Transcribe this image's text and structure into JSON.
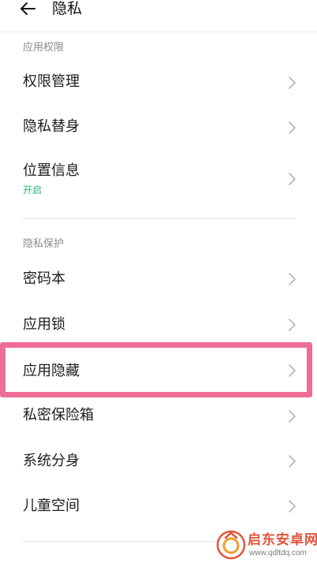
{
  "header": {
    "back_icon": "arrow-left-icon",
    "title": "隐私"
  },
  "colors": {
    "accent_green": "#2bb673",
    "highlight_pink": "#ee6d95",
    "chevron_gray": "#b4b4b4",
    "watermark_orange": "#e0553b"
  },
  "sections": [
    {
      "title": "应用权限",
      "items": [
        {
          "label": "权限管理"
        },
        {
          "label": "隐私替身"
        },
        {
          "label": "位置信息",
          "sub": "开启"
        }
      ]
    },
    {
      "title": "隐私保护",
      "items": [
        {
          "label": "密码本"
        },
        {
          "label": "应用锁"
        },
        {
          "label": "应用隐藏",
          "highlighted": true
        },
        {
          "label": "私密保险箱"
        },
        {
          "label": "系统分身"
        },
        {
          "label": "儿童空间"
        }
      ]
    }
  ],
  "watermark": {
    "name": "启东安卓网",
    "url": "www.qdltdq.com"
  }
}
